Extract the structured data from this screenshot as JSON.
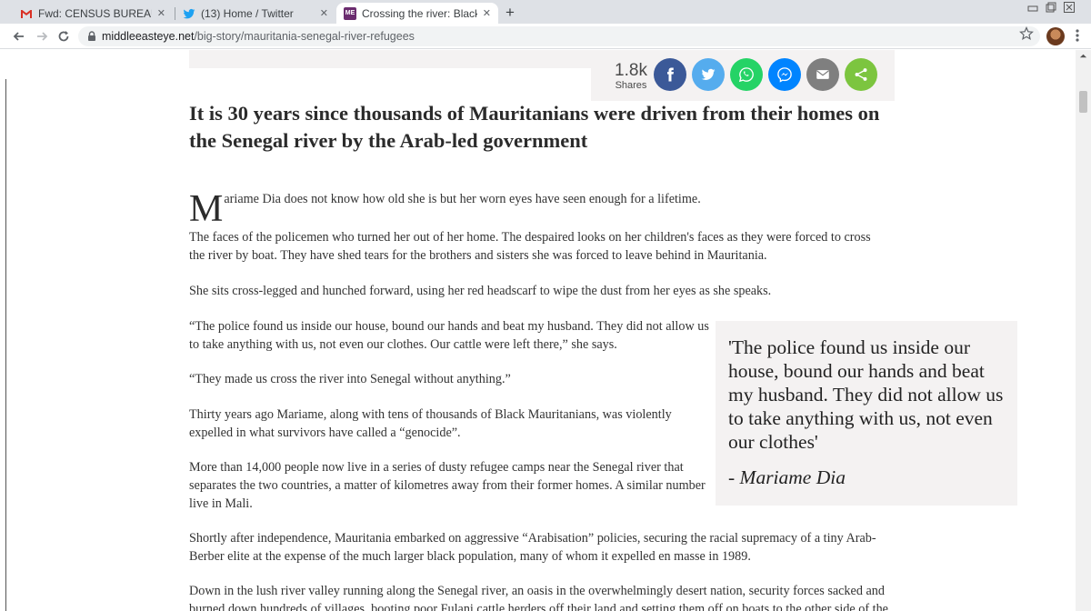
{
  "browser": {
    "tabs": [
      {
        "title": "Fwd: CENSUS BUREAU RECRUITM",
        "favicon": "gmail-icon",
        "active": false
      },
      {
        "title": "(13) Home / Twitter",
        "favicon": "twitter-icon",
        "active": false
      },
      {
        "title": "Crossing the river: Black Mauritan",
        "favicon": "mee-icon",
        "favicon_text": "ME",
        "active": true
      }
    ],
    "new_tab_symbol": "+",
    "close_symbol": "✕",
    "url_host": "middleeasteye.net",
    "url_path": "/big-story/mauritania-senegal-river-refugees"
  },
  "share": {
    "count": "1.8k",
    "label": "Shares",
    "buttons": [
      {
        "name": "facebook",
        "color": "#3b5998"
      },
      {
        "name": "twitter",
        "color": "#55acee"
      },
      {
        "name": "whatsapp",
        "color": "#25d366"
      },
      {
        "name": "messenger",
        "color": "#0084ff"
      },
      {
        "name": "email",
        "color": "#7f7f7f"
      },
      {
        "name": "share",
        "color": "#7cc53f"
      }
    ]
  },
  "article": {
    "standfirst": "It is 30 years since thousands of Mauritanians were driven from their homes on the Senegal river by the Arab-led government",
    "dropcap": "M",
    "p1_rest": "ariame Dia does not know how old she is but her worn eyes have seen enough for a lifetime.",
    "p2": "The faces of the policemen who turned her out of her home. The despaired looks on her children's faces as they were forced to cross the river by boat. They have shed tears for the brothers and sisters she was forced to leave behind in Mauritania.",
    "p3": "She sits cross-legged and hunched forward, using her red headscarf to wipe the dust from her eyes as she speaks.",
    "p4": "“The police found us inside our house, bound our hands and beat my husband. They did not allow us to take anything with us, not even our clothes. Our cattle were left there,” she says.",
    "p5": "“They made us cross the river into Senegal without anything.”",
    "p6": "Thirty years ago Mariame, along with tens of thousands of Black Mauritanians, was violently expelled in what survivors have called a “genocide”.",
    "p7": "More than 14,000 people now live in a series of dusty refugee camps near the Senegal river that separates the two countries, a matter of kilometres away from their former homes. A similar number live in Mali.",
    "p8": "Shortly after independence, Mauritania embarked on aggressive “Arabisation” policies, securing the racial supremacy of a tiny Arab-Berber elite at the expense of the much larger black population, many of whom it expelled en masse in 1989.",
    "p9": "Down in the lush river valley running along the Senegal river, an oasis in the overwhelmingly desert nation, security forces sacked and burned down hundreds of villages, booting poor Fulani cattle herders off their land and setting them off on boats to the other side of the"
  },
  "pullquote": {
    "quote": "'The police found us inside our house, bound our hands and beat my husband. They did not allow us to take anything with us, not even our clothes'",
    "attribution": "- Mariame Dia"
  }
}
